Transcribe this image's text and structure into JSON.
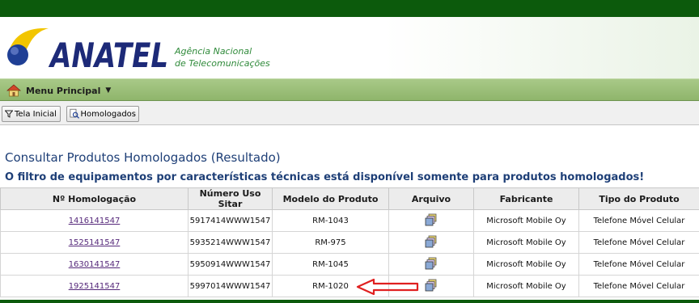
{
  "header": {
    "brand": "ANATEL",
    "agency_line1": "Agência Nacional",
    "agency_line2": "de Telecomunicações",
    "colors": {
      "top_bar": "#0c5a0c",
      "brand_blue": "#1d2a78",
      "brand_yellow": "#f2c500",
      "agency_green": "#2f8a3a"
    }
  },
  "menu": {
    "label": "Menu Principal",
    "icon": "home-icon"
  },
  "toolbar": {
    "tela_inicial": "Tela Inicial",
    "homologados": "Homologados"
  },
  "main": {
    "title": "Consultar Produtos Homologados (Resultado)",
    "filter_note": "O filtro de equipamentos por características técnicas está disponível somente para produtos homologados!"
  },
  "table": {
    "columns": [
      "Nº Homologação",
      "Número Uso Sitar",
      "Modelo do Produto",
      "Arquivo",
      "Fabricante",
      "Tipo do Produto"
    ],
    "rows": [
      {
        "homologacao": "1416141547",
        "sitar": "5917414WWW1547",
        "modelo": "RM-1043",
        "arquivo_icon": "file-stack-icon",
        "fabricante": "Microsoft Mobile Oy",
        "tipo": "Telefone Móvel Celular"
      },
      {
        "homologacao": "1525141547",
        "sitar": "5935214WWW1547",
        "modelo": "RM-975",
        "arquivo_icon": "file-stack-icon",
        "fabricante": "Microsoft Mobile Oy",
        "tipo": "Telefone Móvel Celular"
      },
      {
        "homologacao": "1630141547",
        "sitar": "5950914WWW1547",
        "modelo": "RM-1045",
        "arquivo_icon": "file-stack-icon",
        "fabricante": "Microsoft Mobile Oy",
        "tipo": "Telefone Móvel Celular"
      },
      {
        "homologacao": "1925141547",
        "sitar": "5997014WWW1547",
        "modelo": "RM-1020",
        "arquivo_icon": "file-stack-icon",
        "fabricante": "Microsoft Mobile Oy",
        "tipo": "Telefone Móvel Celular"
      }
    ]
  }
}
